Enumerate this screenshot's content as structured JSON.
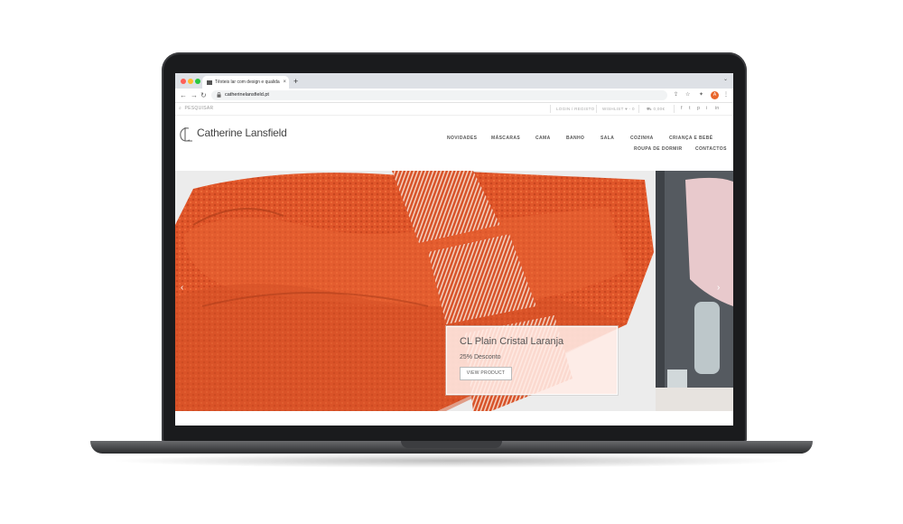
{
  "browser": {
    "tab_title": "Têxteis lar com design e qualidade",
    "new_tab": "+",
    "url": "catherinelansfield.pt",
    "avatar_initial": "A"
  },
  "site": {
    "search_label": "PESQUISAR",
    "login": "LOGIN / REGISTO",
    "wishlist": "WISHLIST ♥ - 0",
    "cart": "0,00€",
    "cart_count": "0",
    "social": [
      "f",
      "t",
      "p",
      "i",
      "in"
    ]
  },
  "logo": {
    "text": "Catherine Lansfield",
    "mark": "CL"
  },
  "nav": {
    "novidades": "NOVIDADES",
    "mascaras": "MÁSCARAS",
    "cama": "CAMA",
    "banho": "BANHO",
    "sala": "SALA",
    "cozinha": "COZINHA",
    "crianca": "CRIANÇA E BEBÉ",
    "roupa": "ROUPA DE DORMIR",
    "contactos": "CONTACTOS"
  },
  "hero": {
    "title": "CL Plain Cristal Laranja",
    "subtitle": "25% Desconto",
    "button": "VIEW PRODUCT",
    "prev": "‹",
    "next": "›"
  },
  "colors": {
    "accent": "#e8662c",
    "towel": "#e0562a"
  }
}
